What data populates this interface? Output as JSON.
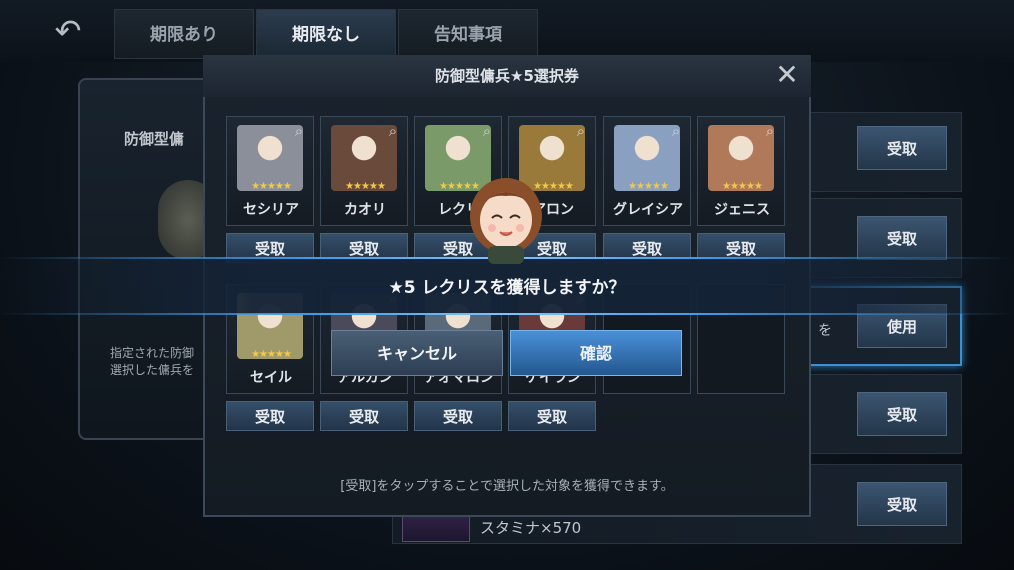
{
  "nav": {
    "tabs": [
      "期限あり",
      "期限なし",
      "告知事項"
    ],
    "active_index": 1
  },
  "background": {
    "item_title": "防御型傭",
    "item_desc": "指定された防御\n選択した傭兵を",
    "row_buttons": [
      "受取",
      "受取",
      "使用",
      "受取",
      "受取"
    ],
    "partial_text": "を",
    "stamina": "スタミナ×570"
  },
  "modal": {
    "title": "防御型傭兵★5選択券",
    "footer": "[受取]をタップすることで選択した対象を獲得できます。",
    "receive_label": "受取",
    "stars": "★★★★★",
    "cards": [
      {
        "name": "セシリア",
        "color": "#8a8f9a"
      },
      {
        "name": "カオリ",
        "color": "#6a4a3a"
      },
      {
        "name": "レクリ",
        "color": "#7a9a6a"
      },
      {
        "name": "アロン",
        "color": "#9a7a3a"
      },
      {
        "name": "グレイシア",
        "color": "#8aa0c0"
      },
      {
        "name": "ジェニス",
        "color": "#b07a5a"
      },
      {
        "name": "セイル",
        "color": "#a09a6a"
      },
      {
        "name": "アルカン",
        "color": "#4a4a5a"
      },
      {
        "name": "アオマロン",
        "color": "#5a6a7a"
      },
      {
        "name": "ケイラン",
        "color": "#6a3a3a"
      }
    ]
  },
  "confirm": {
    "question": "★5 レクリスを獲得しますか？",
    "cancel_label": "キャンセル",
    "ok_label": "確認"
  }
}
